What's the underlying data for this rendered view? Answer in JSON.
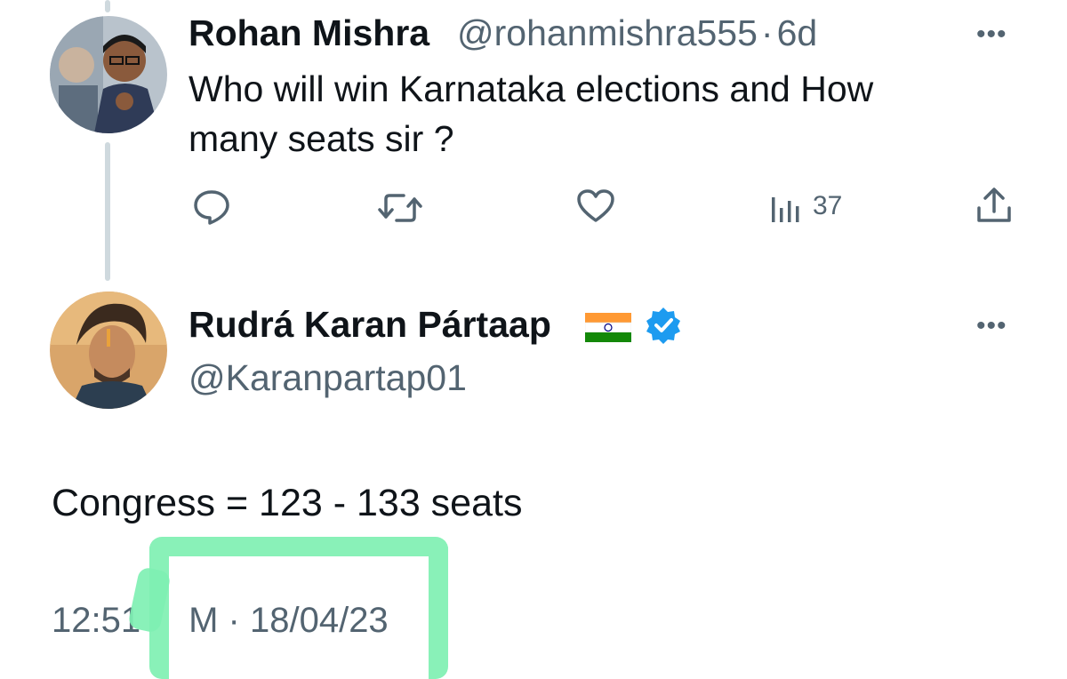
{
  "original_tweet": {
    "display_name": "Rohan Mishra",
    "handle": "@rohanmishra555",
    "separator": "·",
    "time_ago": "6d",
    "text_line1": "Who will win Karnataka elections and How",
    "text_line2": "many seats sir ?",
    "actions": {
      "reply_icon": "reply-icon",
      "retweet_icon": "retweet-icon",
      "like_icon": "heart-icon",
      "views_icon": "analytics-icon",
      "views_count": "37",
      "share_icon": "share-icon"
    },
    "more_label": "•••"
  },
  "reply_tweet": {
    "display_name": "Rudrá Karan Pártaap",
    "flag_icon": "india-flag-icon",
    "verified_icon": "verified-badge-icon",
    "handle": "@Karanpartap01",
    "more_label": "•••",
    "text": "Congress = 123 - 133 seats",
    "timestamp_time": "12:51",
    "timestamp_rest": "M · 18/04/23"
  },
  "colors": {
    "text_primary": "#0f1419",
    "text_secondary": "#536471",
    "verified_blue": "#1d9bf0",
    "highlight_green": "#7ff0b3"
  }
}
